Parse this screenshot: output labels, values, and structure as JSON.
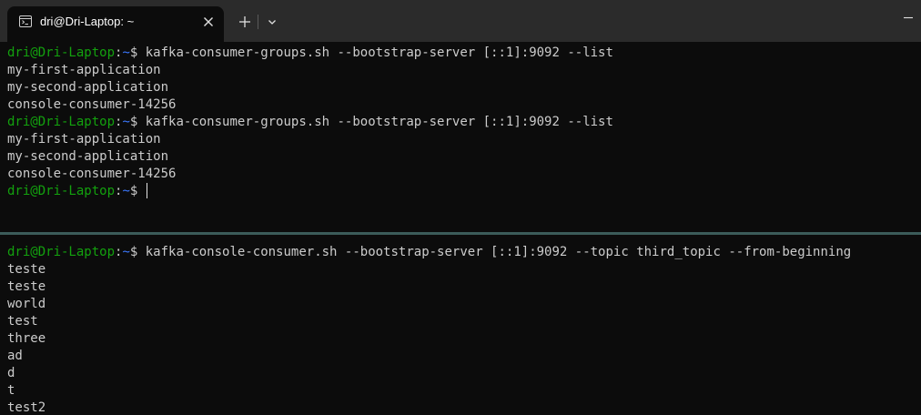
{
  "tab": {
    "title": "dri@Dri-Laptop: ~",
    "icon": "terminal-icon"
  },
  "colors": {
    "user": "#13a10e",
    "path": "#3b78ff",
    "text": "#cccccc",
    "background": "#0c0c0c",
    "divider": "#3c5c5a"
  },
  "prompt": {
    "user_host": "dri@Dri-Laptop",
    "colon": ":",
    "path": "~",
    "symbol": "$"
  },
  "top_pane": {
    "lines": [
      {
        "type": "prompt",
        "command": " kafka-consumer-groups.sh --bootstrap-server [::1]:9092 --list"
      },
      {
        "type": "output",
        "text": "my-first-application"
      },
      {
        "type": "output",
        "text": "my-second-application"
      },
      {
        "type": "output",
        "text": "console-consumer-14256"
      },
      {
        "type": "prompt",
        "command": " kafka-consumer-groups.sh --bootstrap-server [::1]:9092 --list"
      },
      {
        "type": "output",
        "text": "my-first-application"
      },
      {
        "type": "output",
        "text": "my-second-application"
      },
      {
        "type": "output",
        "text": "console-consumer-14256"
      },
      {
        "type": "prompt",
        "command": " ",
        "cursor": true
      }
    ]
  },
  "bottom_pane": {
    "lines": [
      {
        "type": "prompt",
        "command": " kafka-console-consumer.sh --bootstrap-server [::1]:9092 --topic third_topic --from-beginning"
      },
      {
        "type": "output",
        "text": "teste"
      },
      {
        "type": "output",
        "text": "teste"
      },
      {
        "type": "output",
        "text": "world"
      },
      {
        "type": "output",
        "text": "test"
      },
      {
        "type": "output",
        "text": "three"
      },
      {
        "type": "output",
        "text": "ad"
      },
      {
        "type": "output",
        "text": "d"
      },
      {
        "type": "output",
        "text": "t"
      },
      {
        "type": "output",
        "text": "test2"
      }
    ]
  }
}
